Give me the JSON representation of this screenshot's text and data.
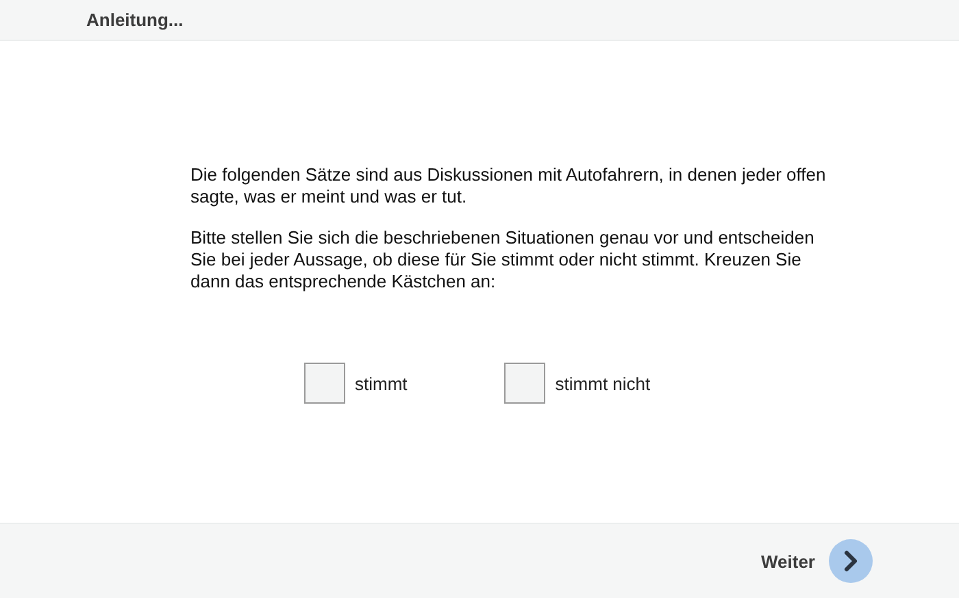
{
  "header": {
    "title": "Anleitung..."
  },
  "paragraphs": [
    "Die folgenden Sätze sind aus Diskussionen mit Autofahrern, in denen jeder offen sagte, was er meint und was er tut.",
    "Bitte stellen Sie sich die beschriebenen Situationen genau vor und entscheiden Sie bei jeder Aussage, ob diese für Sie stimmt oder nicht stimmt. Kreuzen Sie dann das entsprechende Kästchen an:"
  ],
  "options": [
    {
      "label": "stimmt",
      "checked": false
    },
    {
      "label": "stimmt nicht",
      "checked": false
    }
  ],
  "footer": {
    "next_label": "Weiter"
  }
}
